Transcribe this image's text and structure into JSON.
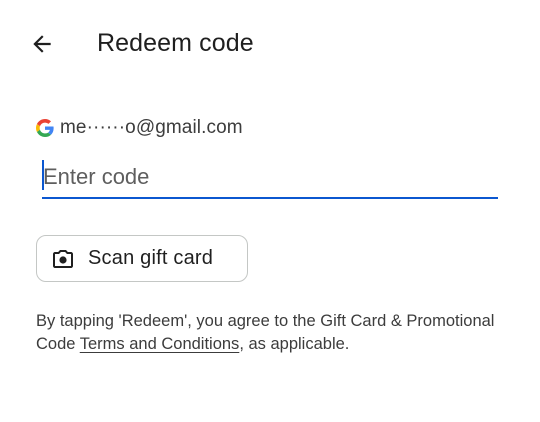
{
  "app_bar": {
    "title": "Redeem code",
    "back_icon": "arrow-back-icon"
  },
  "account": {
    "provider_icon": "google-g-icon",
    "email": "me······o@gmail.com"
  },
  "code_field": {
    "placeholder": "Enter code",
    "value": ""
  },
  "scan_button": {
    "icon": "camera-icon",
    "label": "Scan gift card"
  },
  "terms": {
    "prefix": "By tapping 'Redeem', you agree to the Gift Card & Promotional Code ",
    "link_text": "Terms and Conditions",
    "suffix": ", as applicable."
  },
  "colors": {
    "accent": "#0b57d0",
    "text_primary": "#1f1f1f",
    "text_secondary": "#3c3c3c",
    "outline": "#c4c7c5"
  }
}
